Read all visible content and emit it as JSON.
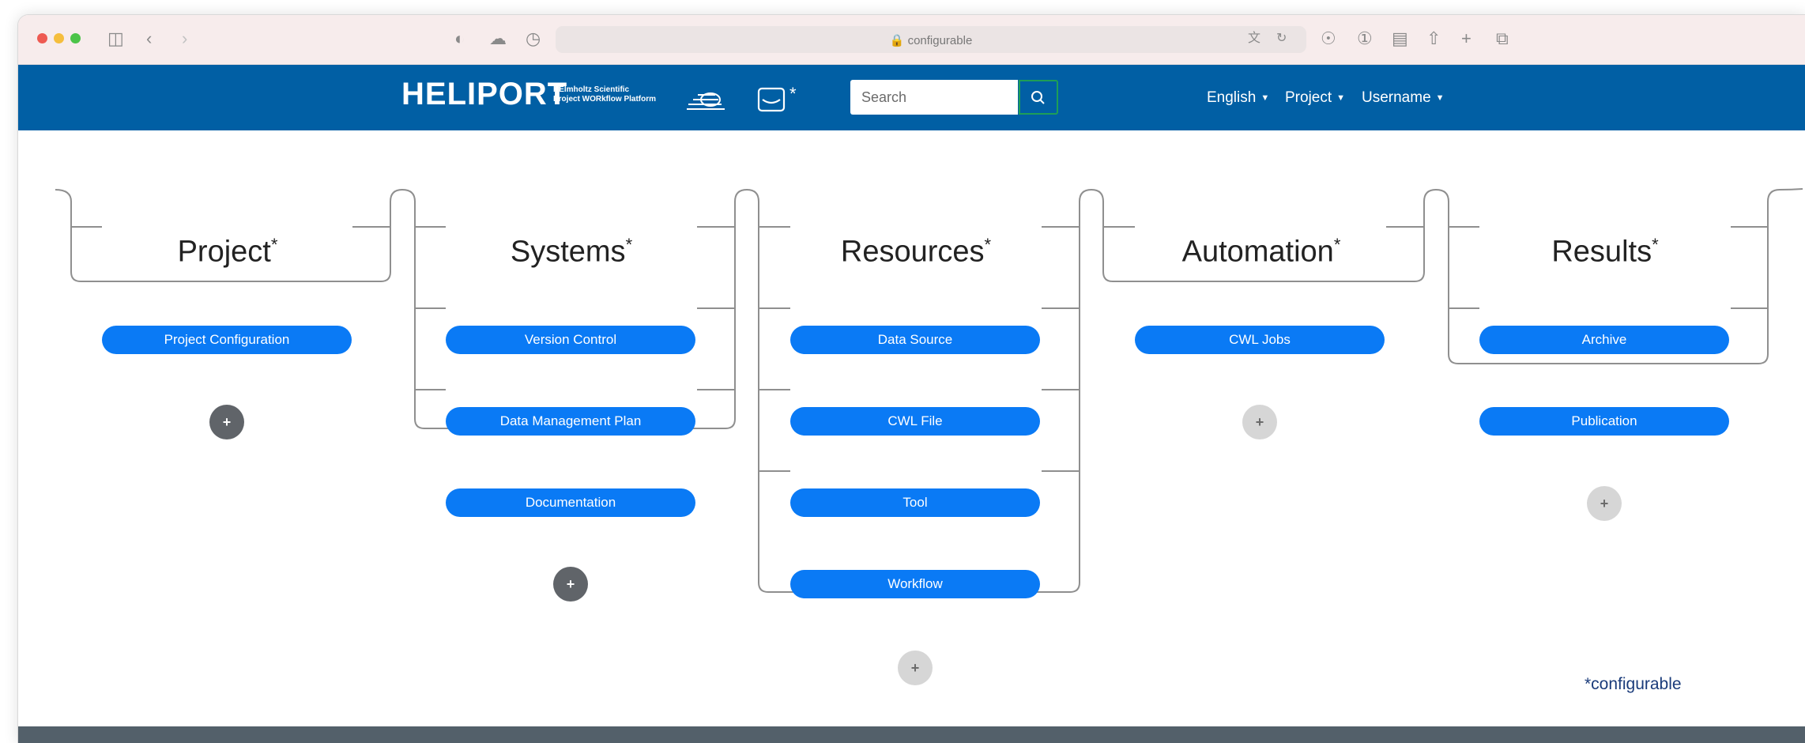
{
  "browser": {
    "url": "configurable",
    "traffic_colors": [
      "#ee5a52",
      "#f5be3d",
      "#4cc449"
    ]
  },
  "navbar": {
    "logo": "HELIPORT",
    "subtitle_line1": "HElmholtz Scientific",
    "subtitle_line2": "Project WORkflow Platform",
    "asterisk": "*",
    "search_placeholder": "Search",
    "menu": [
      {
        "label": "English",
        "dropdown": true
      },
      {
        "label": "Project",
        "dropdown": true
      },
      {
        "label": "Username",
        "dropdown": true
      }
    ],
    "bg_color": "#015fa4"
  },
  "columns": [
    {
      "title": "Project",
      "items": [
        "Project Configuration"
      ],
      "add_style": "dark"
    },
    {
      "title": "Systems",
      "items": [
        "Version Control",
        "Data Management Plan",
        "Documentation"
      ],
      "add_style": "dark"
    },
    {
      "title": "Resources",
      "items": [
        "Data Source",
        "CWL File",
        "Tool",
        "Workflow"
      ],
      "add_style": "light"
    },
    {
      "title": "Automation",
      "items": [
        "CWL Jobs"
      ],
      "add_style": "light"
    },
    {
      "title": "Results",
      "items": [
        "Archive",
        "Publication"
      ],
      "add_style": "light"
    }
  ],
  "title_asterisk": "*",
  "add_symbol": "+",
  "footnote": "*configurable",
  "colors": {
    "pill": "#0a7af5",
    "footer": "#53606a"
  }
}
